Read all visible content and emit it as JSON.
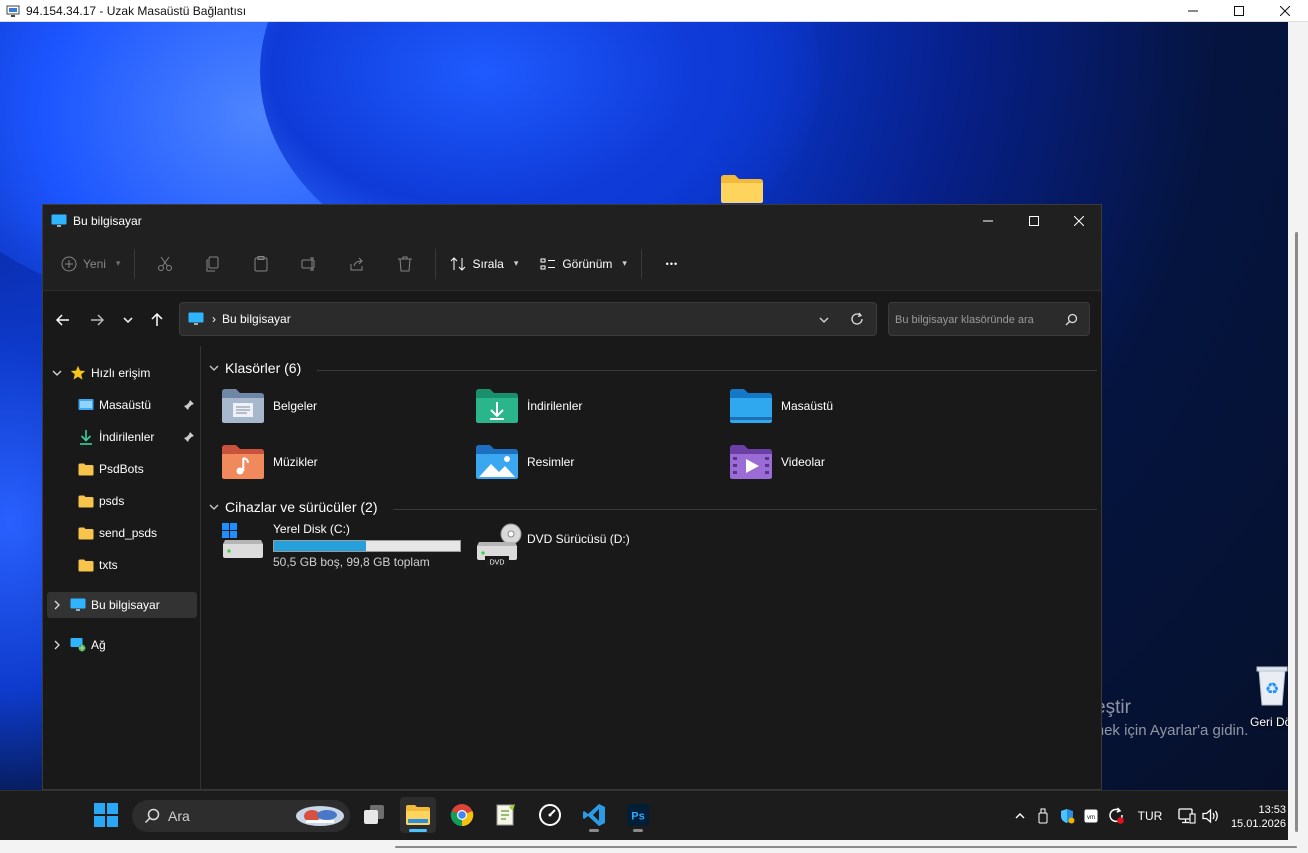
{
  "rdp": {
    "title": "94.154.34.17 - Uzak Masaüstü Bağlantısı"
  },
  "desktop": {
    "recycle_bin_label": "Geri Dönüşüm",
    "activation_title": "Windows'u Etkinleştir",
    "activation_subtitle": "Windows'u etkinleştirmek için Ayarlar'a gidin."
  },
  "explorer": {
    "title": "Bu bilgisayar",
    "toolbar": {
      "new_label": "Yeni",
      "sort_label": "Sırala",
      "view_label": "Görünüm",
      "more_label": "•••"
    },
    "address": {
      "crumb": "Bu bilgisayar",
      "separator": "›"
    },
    "search": {
      "placeholder": "Bu bilgisayar klasöründe ara"
    },
    "sidebar": {
      "quick_access": "Hızlı erişim",
      "items": [
        {
          "label": "Masaüstü",
          "pinned": true
        },
        {
          "label": "İndirilenler",
          "pinned": true
        },
        {
          "label": "PsdBots",
          "pinned": false
        },
        {
          "label": "psds",
          "pinned": false
        },
        {
          "label": "send_psds",
          "pinned": false
        },
        {
          "label": "txts",
          "pinned": false
        }
      ],
      "this_pc": "Bu bilgisayar",
      "network": "Ağ"
    },
    "folders_header": "Klasörler (6)",
    "folders": [
      {
        "label": "Belgeler",
        "icon": "documents-folder-icon"
      },
      {
        "label": "İndirilenler",
        "icon": "downloads-folder-icon"
      },
      {
        "label": "Masaüstü",
        "icon": "desktop-folder-icon"
      },
      {
        "label": "Müzikler",
        "icon": "music-folder-icon"
      },
      {
        "label": "Resimler",
        "icon": "pictures-folder-icon"
      },
      {
        "label": "Videolar",
        "icon": "videos-folder-icon"
      }
    ],
    "drives_header": "Cihazlar ve sürücüler (2)",
    "drives": [
      {
        "label": "Yerel Disk (C:)",
        "info": "50,5 GB boş, 99,8 GB toplam",
        "used_fraction": 0.494
      },
      {
        "label": "DVD Sürücüsü (D:)",
        "badge": "DVD"
      }
    ]
  },
  "taskbar": {
    "search_label": "Ara",
    "language": "TUR",
    "time": "13:53",
    "date": "15.01.2026",
    "apps": [
      "start-icon",
      "search",
      "task-view-icon",
      "file-explorer-icon",
      "chrome-icon",
      "notepad-plus-plus-icon",
      "speed-gauge-icon",
      "vscode-icon",
      "photoshop-icon"
    ],
    "photoshop_text": "Ps"
  },
  "colors": {
    "accent": "#4cc2ff",
    "disk_fill": "#26a0da",
    "explorer_bg": "#191919",
    "toolbar_bg": "#202020"
  }
}
